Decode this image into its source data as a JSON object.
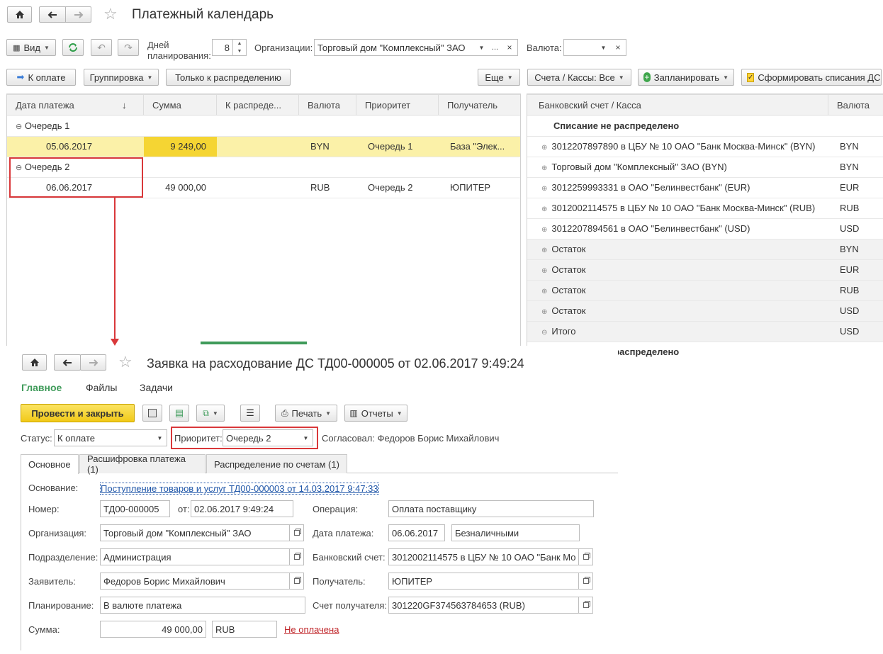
{
  "calendar": {
    "title": "Платежный календарь",
    "toolbar": {
      "view": "Вид",
      "days_label_1": "Дней",
      "days_label_2": "планирования:",
      "days_value": "8",
      "org_label": "Организации:",
      "org_value": "Торговый дом \"Комплексный\" ЗАО",
      "currency_label": "Валюта:",
      "dots": "...",
      "clear": "×"
    },
    "toolbar2": {
      "pay": "К оплате",
      "group": "Группировка",
      "only_dist": "Только к распределению",
      "more": "Еще",
      "accounts": "Счета / Кассы: Все",
      "plan": "Запланировать",
      "form": "Сформировать списания ДС"
    },
    "columns": [
      "Дата платежа",
      "Сумма",
      "К распреде...",
      "Валюта",
      "Приоритет",
      "Получатель"
    ],
    "sort_arrow": "↓",
    "groups": [
      {
        "label": "Очередь 1",
        "rows": [
          {
            "date": "05.06.2017",
            "sum": "9 249,00",
            "dist": "",
            "currency": "BYN",
            "priority": "Очередь 1",
            "recipient": "База \"Элек..."
          }
        ]
      },
      {
        "label": "Очередь 2",
        "rows": [
          {
            "date": "06.06.2017",
            "sum": "49 000,00",
            "dist": "",
            "currency": "RUB",
            "priority": "Очередь 2",
            "recipient": "ЮПИТЕР"
          }
        ]
      }
    ],
    "right_columns": [
      "Банковский счет / Касса",
      "Валюта"
    ],
    "right_rows": [
      {
        "name": "Списание не распределено",
        "currency": ""
      },
      {
        "name": "3012207897890 в ЦБУ № 10 ОАО \"Банк Москва-Минск\" (BYN)",
        "currency": "BYN"
      },
      {
        "name": "Торговый дом \"Комплексный\" ЗАО (BYN)",
        "currency": "BYN"
      },
      {
        "name": "3012259993331 в ОАО \"Белинвестбанк\" (EUR)",
        "currency": "EUR"
      },
      {
        "name": "3012002114575 в ЦБУ № 10 ОАО \"Банк Москва-Минск\" (RUB)",
        "currency": "RUB"
      },
      {
        "name": "3012207894561 в ОАО \"Белинвестбанк\" (USD)",
        "currency": "USD"
      },
      {
        "name": "Остаток",
        "currency": "BYN"
      },
      {
        "name": "Остаток",
        "currency": "EUR"
      },
      {
        "name": "Остаток",
        "currency": "RUB"
      },
      {
        "name": "Остаток",
        "currency": "USD"
      },
      {
        "name": "Итого",
        "currency": "USD"
      },
      {
        "name": "Списание не распределено",
        "currency": ""
      }
    ]
  },
  "doc": {
    "title": "Заявка на расходование ДС ТД00-000005 от 02.06.2017 9:49:24",
    "nav_tabs": [
      "Главное",
      "Файлы",
      "Задачи"
    ],
    "post_close": "Провести и закрыть",
    "print": "Печать",
    "reports": "Отчеты",
    "status_label": "Статус:",
    "status_value": "К оплате",
    "priority_label": "Приоритет:",
    "priority_value": "Очередь 2",
    "approved": "Согласовал: Федоров Борис Михайлович",
    "tabs": [
      "Основное",
      "Расшифровка платежа (1)",
      "Распределение по счетам (1)"
    ],
    "basis_label": "Основание:",
    "basis_value": "Поступление товаров и услуг ТД00-000003 от 14.03.2017 9:47:33",
    "number_label": "Номер:",
    "number_value": "ТД00-000005",
    "from_label": "от:",
    "from_value": "02.06.2017  9:49:24",
    "operation_label": "Операция:",
    "operation_value": "Оплата поставщику",
    "org_label": "Организация:",
    "org_value": "Торговый дом \"Комплексный\" ЗАО",
    "paydate_label": "Дата платежа:",
    "paydate_value": "06.06.2017",
    "paytype_value": "Безналичными",
    "dept_label": "Подразделение:",
    "dept_value": "Администрация",
    "bank_label": "Банковский счет:",
    "bank_value": "3012002114575 в ЦБУ № 10 ОАО \"Банк Мо",
    "applicant_label": "Заявитель:",
    "applicant_value": "Федоров Борис Михайлович",
    "recipient_label": "Получатель:",
    "recipient_value": "ЮПИТЕР",
    "planning_label": "Планирование:",
    "planning_value": "В валюте платежа",
    "recacc_label": "Счет получателя:",
    "recacc_value": "301220GF374563784653 (RUB)",
    "sum_label": "Сумма:",
    "sum_value": "49 000,00",
    "sum_currency": "RUB",
    "paid_status": "Не оплачена"
  },
  "colors": {
    "accent_yellow": "#f5d533",
    "selected_row": "#fbf1a8",
    "highlight_red": "#d9383a",
    "green": "#3f9b5a",
    "link": "#1f56a8"
  }
}
